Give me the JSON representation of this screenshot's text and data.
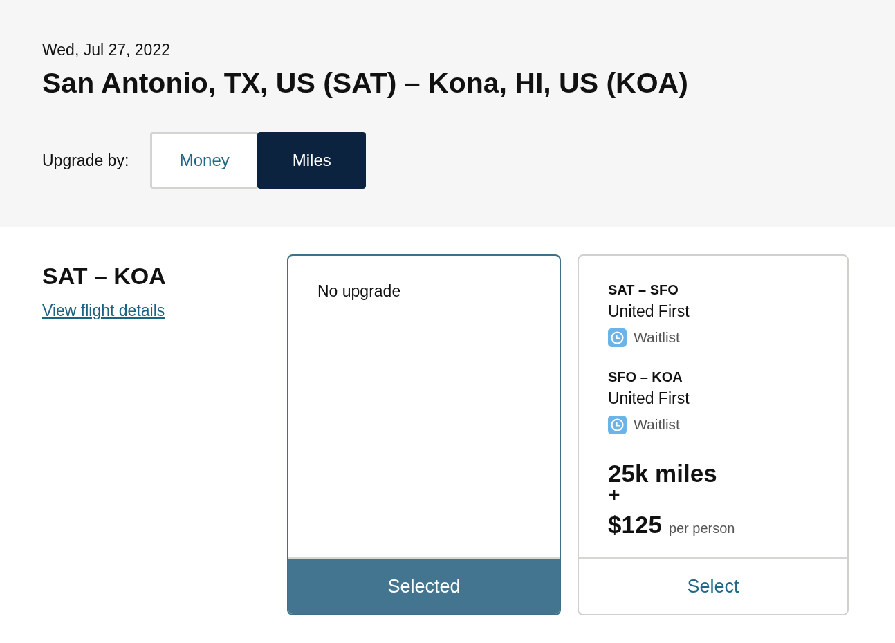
{
  "header": {
    "date": "Wed, Jul 27, 2022",
    "title": "San Antonio, TX, US (SAT) – Kona, HI, US (KOA)",
    "upgrade_by": {
      "label": "Upgrade by:",
      "options": [
        {
          "label": "Money",
          "selected": false
        },
        {
          "label": "Miles",
          "selected": true
        }
      ]
    }
  },
  "segment": {
    "route": "SAT – KOA",
    "details_link": "View flight details"
  },
  "options": [
    {
      "kind": "none",
      "title": "No upgrade",
      "button": "Selected",
      "selected": true
    },
    {
      "kind": "upgrade",
      "flights": [
        {
          "route": "SAT – SFO",
          "cabin": "United First",
          "status": "Waitlist"
        },
        {
          "route": "SFO – KOA",
          "cabin": "United First",
          "status": "Waitlist"
        }
      ],
      "price": {
        "miles": "25k miles",
        "plus": "+",
        "cash": "$125",
        "unit": "per person"
      },
      "button": "Select",
      "selected": false
    }
  ]
}
